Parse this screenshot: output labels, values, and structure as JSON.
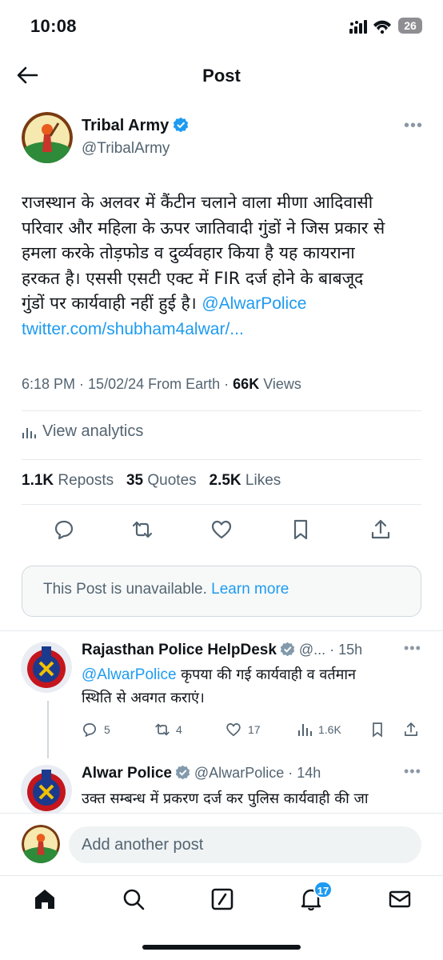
{
  "status_bar": {
    "time": "10:08",
    "battery": "26"
  },
  "header": {
    "title": "Post"
  },
  "post": {
    "author_name": "Tribal Army",
    "author_handle": "@TribalArmy",
    "text_lines": [
      "राजस्थान के अलवर में कैंटीन चलाने वाला मीणा आदिवासी",
      "परिवार और महिला के ऊपर जातिवादी गुंडों ने जिस प्रकार से",
      "हमला करके तोड़फोड व दुर्व्यवहार किया है यह कायराना",
      "हरकत है। एससी एसटी एक्ट में FIR दर्ज होने के बाबजूद",
      "गुंडों पर कार्यवाही नहीं हुई है।"
    ],
    "mention": "@AlwarPolice",
    "url": "twitter.com/shubham4alwar/...",
    "time": "6:18 PM",
    "date": "15/02/24",
    "source": "From Earth",
    "views_count": "66K",
    "views_label": "Views",
    "analytics_label": "View analytics",
    "reposts_count": "1.1K",
    "reposts_label": "Reposts",
    "quotes_count": "35",
    "quotes_label": "Quotes",
    "likes_count": "2.5K",
    "likes_label": "Likes",
    "unavailable_text": "This Post is unavailable.",
    "learn_more": "Learn more"
  },
  "replies": [
    {
      "name": "Rajasthan Police HelpDesk",
      "handle": "@...",
      "time": "15h",
      "mention": "@AlwarPolice",
      "text_1": "कृपया की गई कार्यवाही व वर्तमान",
      "text_2": "स्थिति से अवगत कराएं।",
      "replies": "5",
      "reposts": "4",
      "likes": "17",
      "views": "1.6K"
    },
    {
      "name": "Alwar Police",
      "handle": "@AlwarPolice",
      "time": "14h",
      "text_1": "उक्त सम्बन्ध में प्रकरण दर्ज कर पुलिस कार्यवाही की जा"
    }
  ],
  "compose": {
    "placeholder": "Add another post"
  },
  "tabbar": {
    "notifications_badge": "17"
  },
  "colors": {
    "accent": "#1d9bf0",
    "text": "#0f1419",
    "muted": "#536471"
  },
  "icons": [
    "back-arrow-icon",
    "verified-badge-icon",
    "more-icon",
    "analytics-icon",
    "reply-icon",
    "repost-icon",
    "like-icon",
    "bookmark-icon",
    "share-icon",
    "home-icon",
    "search-icon",
    "grok-icon",
    "bell-icon",
    "mail-icon"
  ]
}
